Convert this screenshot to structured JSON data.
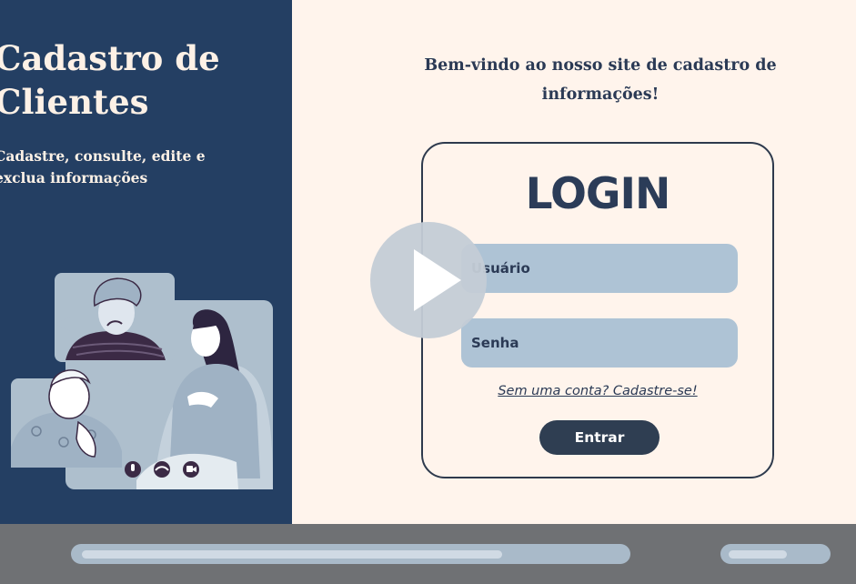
{
  "hero": {
    "title": "Cadastro de Clientes",
    "subtitle": "Cadastre, consulte, edite e exclua informações"
  },
  "welcome": {
    "text": "Bem-vindo ao nosso site de cadastro de informações!"
  },
  "login": {
    "title": "LOGIN",
    "username_placeholder": "Usuário",
    "password_placeholder": "Senha",
    "signup_link": "Sem uma conta? Cadastre-se!",
    "submit_label": "Entrar"
  },
  "video_controls": {
    "progress_fraction": 0.77,
    "icons": [
      "play-icon",
      "microphone-icon",
      "hang-up-icon",
      "camera-icon"
    ]
  },
  "colors": {
    "sidebar": "#243f63",
    "background": "#fff4ec",
    "field": "#aec3d5",
    "button": "#2f3e52",
    "bottom_bar": "#6f7174"
  }
}
